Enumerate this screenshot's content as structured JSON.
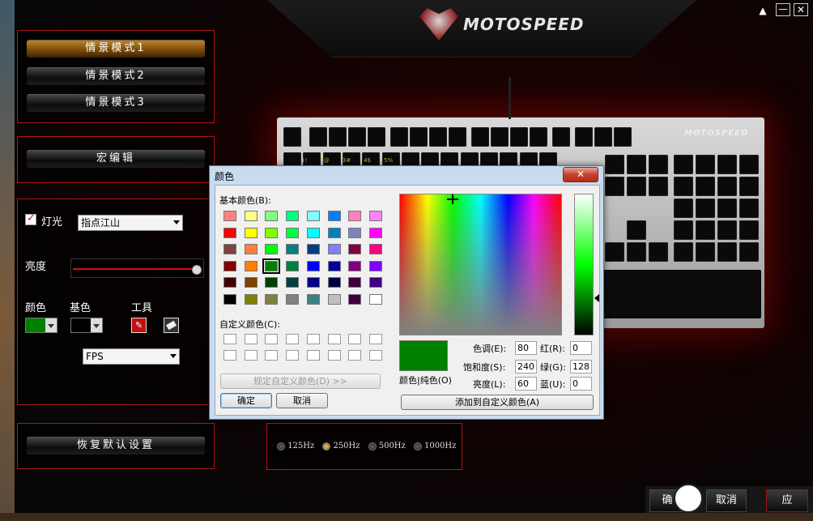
{
  "brand": {
    "name": "MOTOSPEED"
  },
  "window_controls": {
    "up": "▲",
    "min": "—",
    "close": "✕"
  },
  "modes": [
    {
      "label": "情景模式1",
      "active": true
    },
    {
      "label": "情景模式2",
      "active": false
    },
    {
      "label": "情景模式3",
      "active": false
    }
  ],
  "macro_button": "宏编辑",
  "lighting": {
    "checkbox_label": "灯光",
    "checked": true,
    "effect_selected": "指点江山",
    "brightness_label": "亮度",
    "brightness_level": 1.0,
    "color_label": "颜色",
    "base_color_label": "基色",
    "tools_label": "工具",
    "color_value": "#008000",
    "base_color_value": "#000000",
    "game_mode_selected": "FPS"
  },
  "restore_button": "恢复默认设置",
  "polling": {
    "options": [
      "125Hz",
      "250Hz",
      "500Hz",
      "1000Hz"
    ],
    "selected": "250Hz"
  },
  "bottom_buttons": {
    "confirm": "确",
    "cancel": "取消",
    "apply": "应"
  },
  "keyboard": {
    "brand": "MOTOSPEED",
    "legends": [
      "1!",
      "2@",
      "3#",
      "4$",
      "5%"
    ]
  },
  "color_dialog": {
    "title": "颜色",
    "close": "✕",
    "basic_colors_label": "基本颜色(B):",
    "custom_colors_label": "自定义颜色(C):",
    "define_custom_button": "规定自定义颜色(D) >>",
    "ok_button": "确定",
    "cancel_button": "取消",
    "color_solid_label": "颜色|纯色(O)",
    "hue_label": "色调(E):",
    "hue": "80",
    "sat_label": "饱和度(S):",
    "sat": "240",
    "lum_label": "亮度(L):",
    "lum": "60",
    "red_label": "红(R):",
    "red": "0",
    "green_label": "绿(G):",
    "green": "128",
    "blue_label": "蓝(U):",
    "blue": "0",
    "add_custom_button": "添加到自定义颜色(A)",
    "current_color": "#008000",
    "basic_colors": [
      [
        "#ff8080",
        "#ffff80",
        "#80ff80",
        "#00ff80",
        "#80ffff",
        "#0080ff",
        "#ff80c0",
        "#ff80ff"
      ],
      [
        "#ff0000",
        "#ffff00",
        "#80ff00",
        "#00ff40",
        "#00ffff",
        "#0080c0",
        "#8080c0",
        "#ff00ff"
      ],
      [
        "#804040",
        "#ff8040",
        "#00ff00",
        "#008080",
        "#004080",
        "#8080ff",
        "#800040",
        "#ff0080"
      ],
      [
        "#800000",
        "#ff8000",
        "#008000",
        "#008040",
        "#0000ff",
        "#0000a0",
        "#800080",
        "#8000ff"
      ],
      [
        "#400000",
        "#804000",
        "#004000",
        "#004040",
        "#000080",
        "#000040",
        "#400040",
        "#400080"
      ],
      [
        "#000000",
        "#808000",
        "#808040",
        "#808080",
        "#408080",
        "#c0c0c0",
        "#400040",
        "#ffffff"
      ]
    ],
    "selected_basic": [
      3,
      2
    ]
  }
}
